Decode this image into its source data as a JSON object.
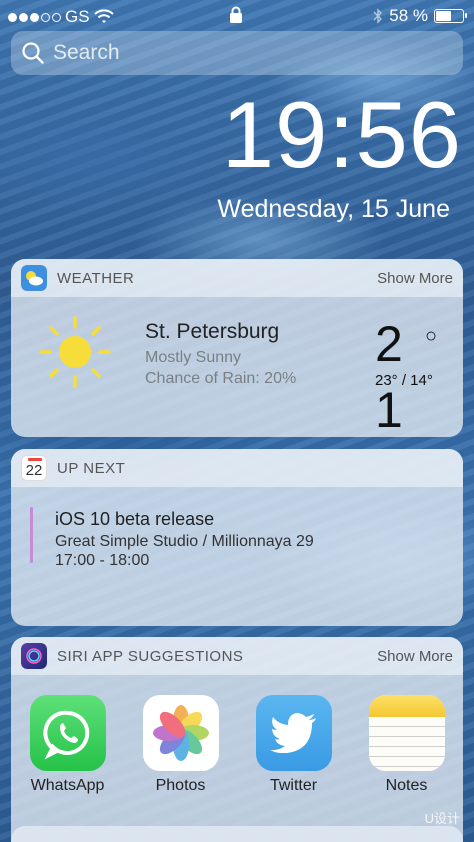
{
  "status_bar": {
    "carrier": "GS",
    "battery": "58 %",
    "battery_level": 0.58
  },
  "search": {
    "placeholder": "Search"
  },
  "clock": {
    "time": "19:56",
    "date": "Wednesday, 15 June"
  },
  "weather_widget": {
    "title": "WEATHER",
    "show_more": "Show More",
    "city": "St. Petersburg",
    "condition": "Mostly Sunny",
    "rain": "Chance of Rain: 20%",
    "temp_first_digit": "2",
    "degree_symbol": "○",
    "range": "23° / 14°",
    "temp_second_digit": "1"
  },
  "up_next_widget": {
    "title": "UP NEXT",
    "calendar_day": "22",
    "event_title": "iOS 10 beta release",
    "event_location": "Great Simple Studio / Millionnaya 29",
    "event_time": "17:00 - 18:00"
  },
  "siri_widget": {
    "title": "SIRI APP SUGGESTIONS",
    "show_more": "Show More",
    "apps": [
      {
        "label": "WhatsApp",
        "icon": "whatsapp-icon"
      },
      {
        "label": "Photos",
        "icon": "photos-icon"
      },
      {
        "label": "Twitter",
        "icon": "twitter-icon"
      },
      {
        "label": "Notes",
        "icon": "notes-icon"
      }
    ]
  },
  "watermark": "U设计",
  "colors": {
    "event_accent": "#c68ad8",
    "whatsapp_green": "#2fcc50",
    "twitter_blue": "#3a9be5",
    "notes_yellow": "#f6d03a",
    "sun_yellow": "#f7dd3a"
  }
}
